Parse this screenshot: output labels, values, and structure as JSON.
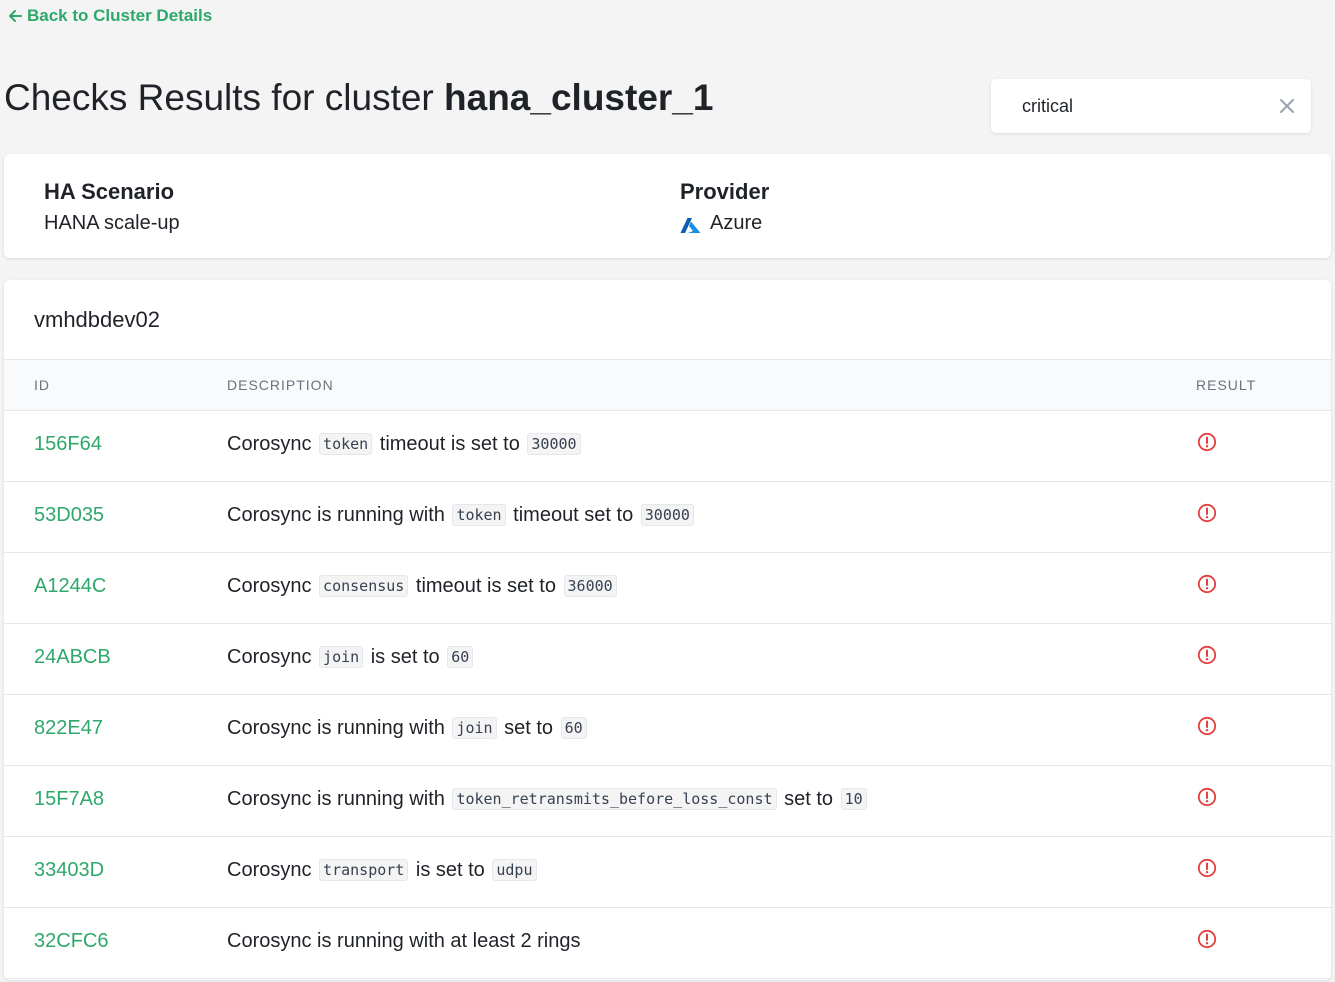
{
  "nav": {
    "back_label": "Back to Cluster Details"
  },
  "header": {
    "title_prefix": "Checks Results for cluster",
    "cluster_name": "hana_cluster_1"
  },
  "search": {
    "value": "critical",
    "placeholder": ""
  },
  "summary": {
    "ha_label": "HA Scenario",
    "ha_value": "HANA scale-up",
    "provider_label": "Provider",
    "provider_value": "Azure"
  },
  "results": {
    "host": "vmhdbdev02",
    "columns": {
      "id": "ID",
      "description": "DESCRIPTION",
      "result": "RESULT"
    },
    "rows": [
      {
        "id": "156F64",
        "desc": [
          {
            "t": "Corosync"
          },
          {
            "c": "token"
          },
          {
            "t": "timeout is set to"
          },
          {
            "c": "30000"
          }
        ],
        "result": "critical"
      },
      {
        "id": "53D035",
        "desc": [
          {
            "t": "Corosync is running with"
          },
          {
            "c": "token"
          },
          {
            "t": "timeout set to"
          },
          {
            "c": "30000"
          }
        ],
        "result": "critical"
      },
      {
        "id": "A1244C",
        "desc": [
          {
            "t": "Corosync"
          },
          {
            "c": "consensus"
          },
          {
            "t": "timeout is set to"
          },
          {
            "c": "36000"
          }
        ],
        "result": "critical"
      },
      {
        "id": "24ABCB",
        "desc": [
          {
            "t": "Corosync"
          },
          {
            "c": "join"
          },
          {
            "t": "is set to"
          },
          {
            "c": "60"
          }
        ],
        "result": "critical"
      },
      {
        "id": "822E47",
        "desc": [
          {
            "t": "Corosync is running with"
          },
          {
            "c": "join"
          },
          {
            "t": "set to"
          },
          {
            "c": "60"
          }
        ],
        "result": "critical"
      },
      {
        "id": "15F7A8",
        "desc": [
          {
            "t": "Corosync is running with"
          },
          {
            "c": "token_retransmits_before_loss_const"
          },
          {
            "t": "set to"
          },
          {
            "c": "10"
          }
        ],
        "result": "critical"
      },
      {
        "id": "33403D",
        "desc": [
          {
            "t": "Corosync"
          },
          {
            "c": "transport"
          },
          {
            "t": "is set to"
          },
          {
            "c": "udpu"
          }
        ],
        "result": "critical"
      },
      {
        "id": "32CFC6",
        "desc": [
          {
            "t": "Corosync is running with at least 2 rings"
          }
        ],
        "result": "critical"
      }
    ]
  },
  "colors": {
    "accent": "#2ea86b",
    "critical": "#e53e3e",
    "azure": "#0078d4"
  }
}
